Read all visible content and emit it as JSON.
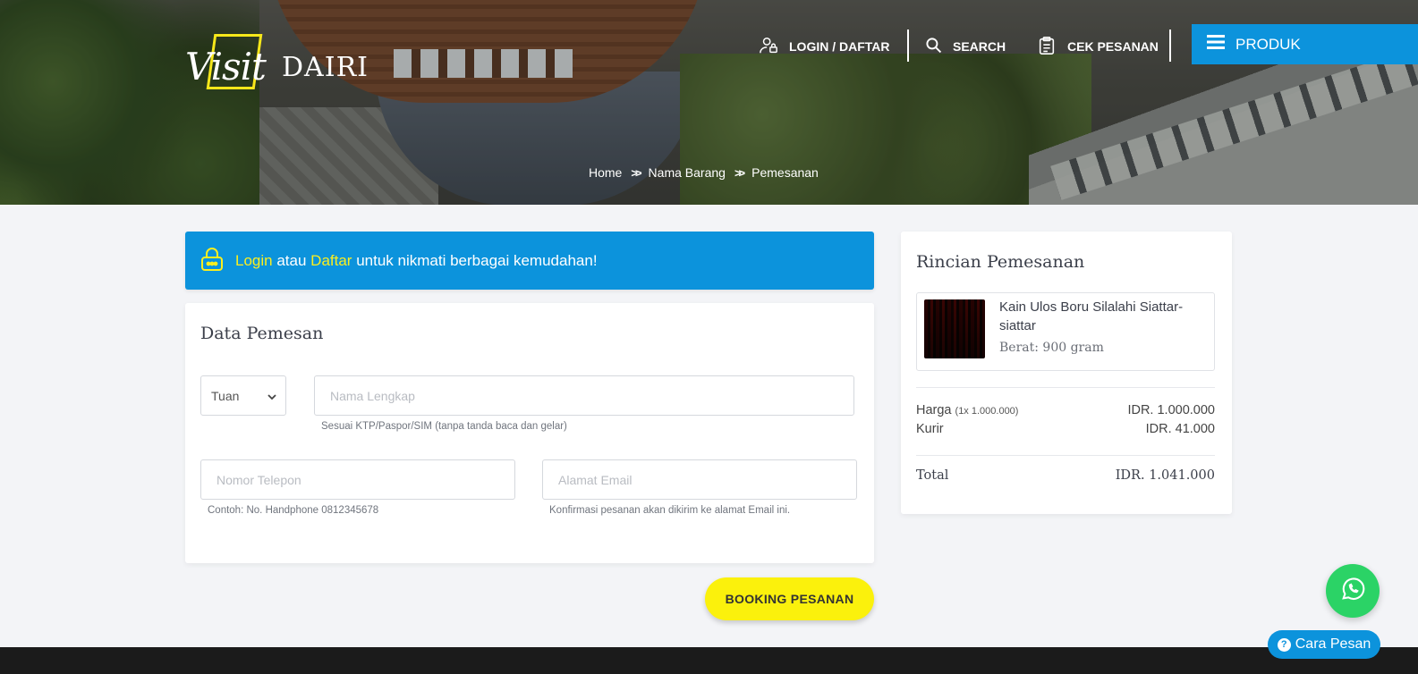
{
  "brand": {
    "logo_script": "Visit",
    "logo_text": "DAIRI"
  },
  "nav": {
    "login_label": "LOGIN / DAFTAR",
    "search_label": "SEARCH",
    "cek_label": "CEK PESANAN",
    "produk_label": "PRODUK"
  },
  "breadcrumb": [
    "Home",
    "Nama Barang",
    "Pemesanan"
  ],
  "login_banner": {
    "login": "Login",
    "atau": "atau",
    "daftar": "Daftar",
    "rest": "untuk nikmati berbagai kemudahan!"
  },
  "form": {
    "title": "Data Pemesan",
    "salutation": "Tuan",
    "name_placeholder": "Nama Lengkap",
    "name_hint": "Sesuai KTP/Paspor/SIM (tanpa tanda baca dan gelar)",
    "phone_placeholder": "Nomor Telepon",
    "phone_hint": "Contoh: No. Handphone 0812345678",
    "email_placeholder": "Alamat Email",
    "email_hint": "Konfirmasi pesanan akan dikirim ke alamat Email ini.",
    "submit_label": "BOOKING PESANAN"
  },
  "summary": {
    "title": "Rincian Pemesanan",
    "product_name": "Kain Ulos Boru Silalahi Siattar-siattar",
    "product_weight": "Berat: 900 gram",
    "harga_label": "Harga",
    "harga_detail": "(1x 1.000.000)",
    "harga_value": "IDR. 1.000.000",
    "kurir_label": "Kurir",
    "kurir_value": "IDR. 41.000",
    "total_label": "Total",
    "total_value": "IDR. 1.041.000"
  },
  "help": {
    "cara_label": "Cara Pesan"
  },
  "colors": {
    "primary": "#0c93dc",
    "accent": "#fbee1f",
    "whatsapp": "#2bd366",
    "footer": "#1b1b1b"
  },
  "icons": [
    "user-icon",
    "search-icon",
    "clipboard-icon",
    "menu-icon",
    "lock-icon",
    "chevron-down-icon",
    "whatsapp-icon",
    "question-icon"
  ]
}
